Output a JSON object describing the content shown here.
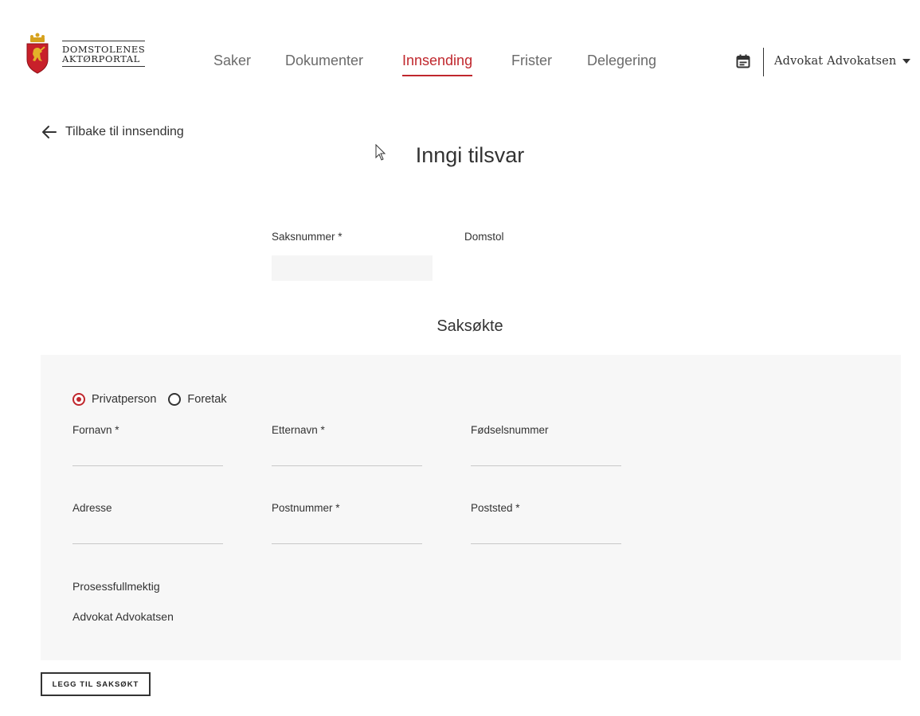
{
  "header": {
    "logo_line1": "DOMSTOLENES",
    "logo_line2": "AKTØRPORTAL",
    "nav": [
      {
        "label": "Saker",
        "active": false
      },
      {
        "label": "Dokumenter",
        "active": false
      },
      {
        "label": "Innsending",
        "active": true
      },
      {
        "label": "Frister",
        "active": false
      },
      {
        "label": "Delegering",
        "active": false
      }
    ],
    "user_name": "Advokat Advokatsen",
    "icons": {
      "calendar": "calendar-icon",
      "user_menu": "chevron-down-icon",
      "logo": "coat-of-arms-lion"
    }
  },
  "back_link": "Tilbake til innsending",
  "page_title": "Inngi tilsvar",
  "case": {
    "saksnummer_label": "Saksnummer *",
    "saksnummer_value": "",
    "domstol_label": "Domstol"
  },
  "party": {
    "section_title": "Saksøkte",
    "type_options": [
      {
        "label": "Privatperson",
        "checked": true
      },
      {
        "label": "Foretak",
        "checked": false
      }
    ],
    "fields": {
      "fornavn": "Fornavn *",
      "etternavn": "Etternavn *",
      "fodselsnummer": "Fødselsnummer",
      "adresse": "Adresse",
      "postnummer": "Postnummer *",
      "poststed": "Poststed *"
    },
    "prosessfullmektig_label": "Prosessfullmektig",
    "prosessfullmektig_value": "Advokat Advokatsen"
  },
  "add_party_button": "LEGG TIL SAKSØKT",
  "colors": {
    "accent": "#c0272d",
    "panel_bg": "#f7f7f7",
    "text": "#333333"
  }
}
